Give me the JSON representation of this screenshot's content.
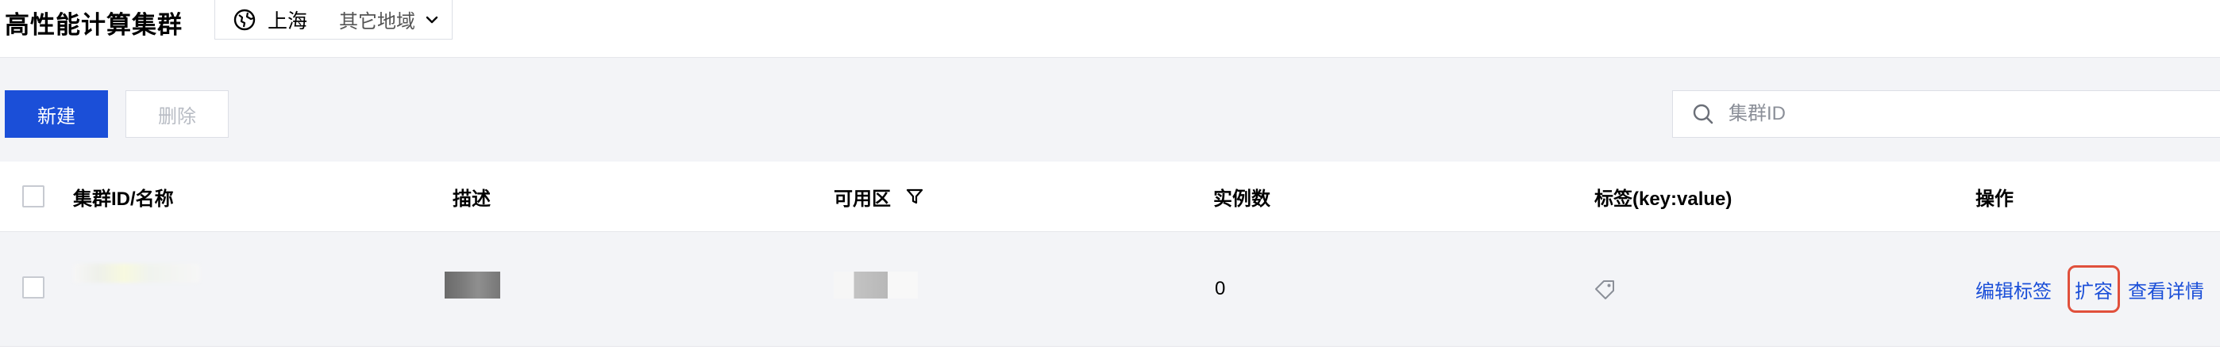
{
  "header": {
    "title": "高性能计算集群",
    "region": {
      "current": "上海",
      "other": "其它地域"
    }
  },
  "toolbar": {
    "create_label": "新建",
    "delete_label": "删除",
    "search": {
      "placeholder": "集群ID",
      "value": ""
    }
  },
  "table": {
    "columns": [
      "集群ID/名称",
      "描述",
      "可用区",
      "实例数",
      "标签(key:value)",
      "操作"
    ],
    "rows": [
      {
        "instance_count": "0",
        "actions": [
          "编辑标签",
          "扩容",
          "查看详情"
        ]
      }
    ]
  },
  "icons": {
    "region": "globe-icon",
    "region_dropdown": "chevron-down-icon",
    "search": "search-icon",
    "zone_filter": "filter-icon",
    "tag": "tag-icon"
  },
  "colors": {
    "primary": "#1b4fd8",
    "highlight_border": "#e0503c",
    "page_bg": "#f3f4f7"
  }
}
